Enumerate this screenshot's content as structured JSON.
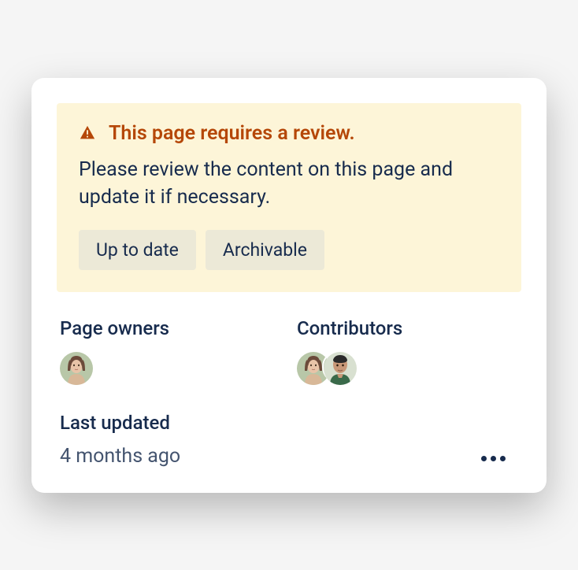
{
  "banner": {
    "title": "This page requires a review.",
    "body": "Please review the content on this page and update it if necessary.",
    "buttons": {
      "up_to_date": "Up to date",
      "archivable": "Archivable"
    }
  },
  "sections": {
    "page_owners_label": "Page owners",
    "contributors_label": "Contributors",
    "last_updated_label": "Last updated",
    "last_updated_value": "4 months ago"
  }
}
